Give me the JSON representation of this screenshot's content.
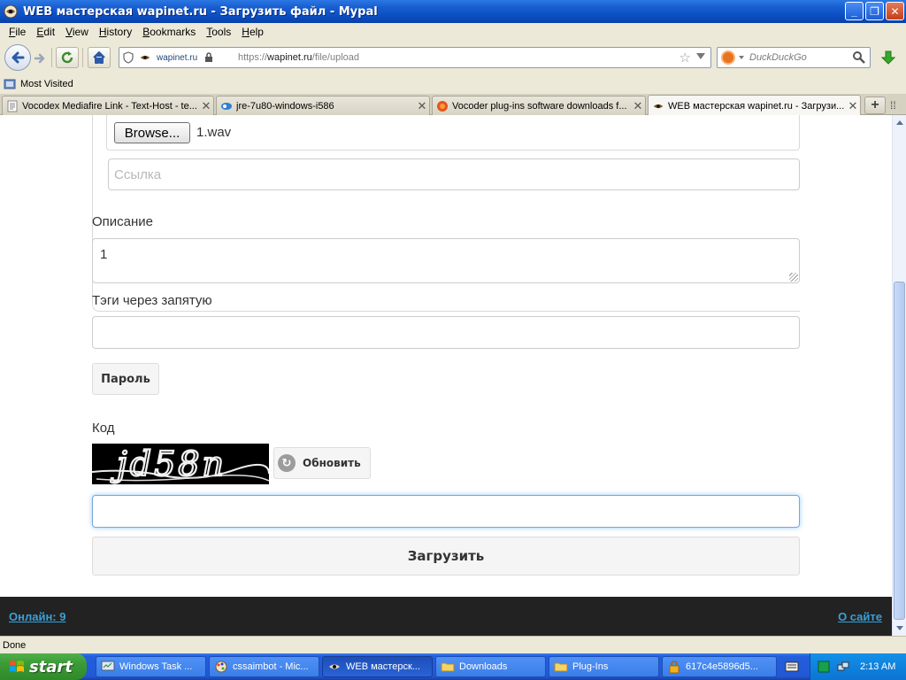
{
  "window": {
    "title": "WEB мастерская wapinet.ru - Загрузить файл - Mypal",
    "minimize_label": "_",
    "maximize_label": "❐",
    "close_label": "✕"
  },
  "menu": {
    "items": [
      {
        "underline": "F",
        "rest": "ile"
      },
      {
        "underline": "E",
        "rest": "dit"
      },
      {
        "underline": "V",
        "rest": "iew"
      },
      {
        "underline": "H",
        "rest": "istory"
      },
      {
        "underline": "B",
        "rest": "ookmarks"
      },
      {
        "underline": "T",
        "rest": "ools"
      },
      {
        "underline": "H",
        "rest": "elp"
      }
    ]
  },
  "nav": {
    "site_identity": "wapinet.ru",
    "url_prefix": "https://",
    "url_host": "wapinet.ru",
    "url_path": "/file/upload",
    "search_placeholder": "DuckDuckGo"
  },
  "bookmarks": {
    "most_visited": "Most Visited"
  },
  "tabs": [
    {
      "title": "Vocodex Mediafire Link - Text-Host - te...",
      "favicon": "page-icon",
      "close": "✕"
    },
    {
      "title": "jre-7u80-windows-i586",
      "favicon": "download-icon",
      "close": "✕"
    },
    {
      "title": "Vocoder plug-ins software downloads f...",
      "favicon": "firefox-icon",
      "close": "✕"
    },
    {
      "title": "WEB мастерская wapinet.ru - Загрузи...",
      "favicon": "wapinet-icon",
      "close": "✕"
    }
  ],
  "tab_new_label": "+",
  "page": {
    "browse_label": "Browse...",
    "file_name": "1.wav",
    "link_placeholder": "Ссылка",
    "description_label": "Описание",
    "description_value": "1",
    "tags_label": "Тэги через запятую",
    "tags_value": "",
    "password_button": "Пароль",
    "code_label": "Код",
    "captcha_text": "jd58n",
    "refresh_button": "Обновить",
    "code_value": "",
    "submit_button": "Загрузить",
    "footer_online": "Онлайн: 9",
    "footer_about": "О сайте"
  },
  "status": {
    "text": "Done"
  },
  "taskbar": {
    "start_label": "start",
    "tasks": [
      {
        "label": "Windows Task ...",
        "icon": "task-manager-icon"
      },
      {
        "label": "cssaimbot - Mic...",
        "icon": "paint-icon"
      },
      {
        "label": "WEB мастерск...",
        "icon": "browser-icon",
        "active": true
      },
      {
        "label": "Downloads",
        "icon": "folder-icon"
      },
      {
        "label": "Plug-Ins",
        "icon": "folder-icon"
      },
      {
        "label": "617c4e5896d5...",
        "icon": "lock-icon"
      }
    ],
    "clock": "2:13 AM"
  },
  "colors": {
    "link_accent": "#3aa0d8",
    "footer_bg": "#222222",
    "titlebar_blue": "#0a4ec3",
    "start_green": "#3c9a36"
  }
}
